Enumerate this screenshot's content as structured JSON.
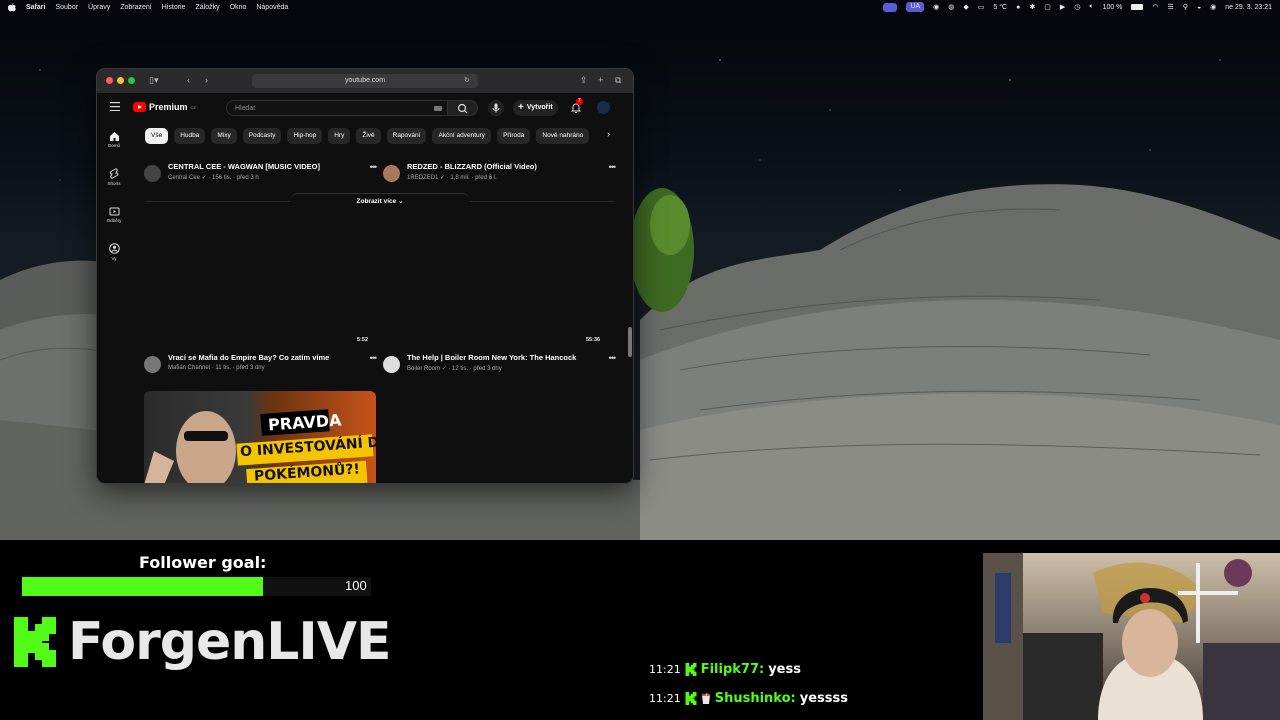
{
  "menubar": {
    "app": "Safari",
    "items": [
      "Soubor",
      "Úpravy",
      "Zobrazení",
      "Historie",
      "Záložky",
      "Okno",
      "Nápověda"
    ],
    "keyboard": "UA",
    "weather": "5 °C",
    "battery": "100 %",
    "datetime": "ne 29. 3. 23:21"
  },
  "safari": {
    "url": "youtube.com"
  },
  "youtube": {
    "logo": "Premium",
    "logo_region": "CZ",
    "search_placeholder": "Hledat",
    "create_label": "Vytvořit",
    "notification_count": "7",
    "chips": [
      "Vše",
      "Hudba",
      "Mixy",
      "Podcasty",
      "Hip-hop",
      "Hry",
      "Živě",
      "Rapování",
      "Akční adventury",
      "Příroda",
      "Nově nahráno"
    ],
    "rail": [
      {
        "label": "Domů",
        "icon": "home-icon"
      },
      {
        "label": "Shorts",
        "icon": "shorts-icon"
      },
      {
        "label": "Odběry",
        "icon": "subscriptions-icon"
      },
      {
        "label": "Vy",
        "icon": "you-icon"
      }
    ],
    "videos_top": [
      {
        "title": "CENTRAL CEE - WAGWAN [MUSIC VIDEO]",
        "channel": "Central Cee",
        "views": "156 tis.",
        "age": "před 3 h"
      },
      {
        "title": "REDZED - BLIZZARD (Official Video)",
        "channel": "1REDZED1",
        "views": "1,8 mil.",
        "age": "před 6 l."
      }
    ],
    "show_more": "Zobrazit více",
    "videos_bottom": [
      {
        "title": "Vrací se Mafia do Empire Bay? Co zatím víme",
        "channel": "Mafián Channel",
        "views": "11 tis.",
        "age": "před 3 dny",
        "duration": "5:52"
      },
      {
        "title": "The Help | Boiler Room New York: The Hancock",
        "channel": "Boiler Room",
        "views": "12 tis.",
        "age": "před 3 dny",
        "duration": "55:36"
      }
    ],
    "thumbnail_text": [
      "PRAVDA",
      "O INVESTOVÁNÍ DO",
      "POKÉMONŮ?!"
    ]
  },
  "overlay": {
    "goal_title": "Follower goal:",
    "goal_max": "100",
    "goal_progress": 0.69,
    "brand": "ForgenLIVE",
    "brand_color": "#53fc18"
  },
  "chat": [
    {
      "time": "11:21",
      "user": "Filipk77:",
      "message": "yess",
      "badge": "cup-icon-none"
    },
    {
      "time": "11:21",
      "user": "Shushinko:",
      "message": "yessss",
      "badge": "cup-icon"
    }
  ]
}
